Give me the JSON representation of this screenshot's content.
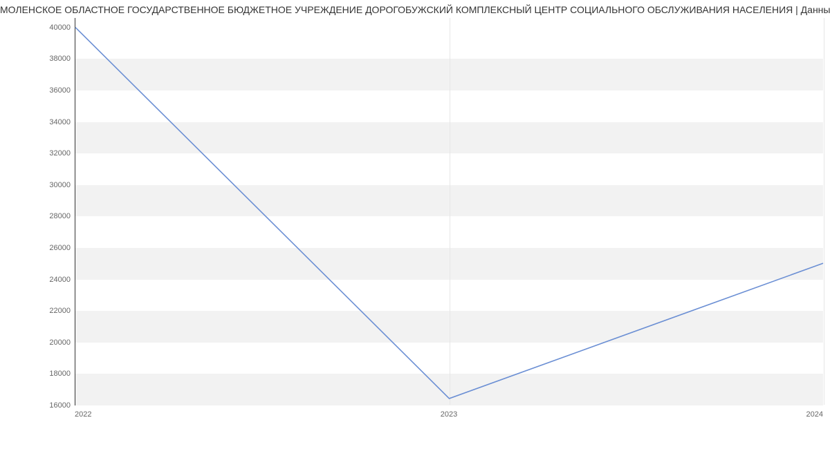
{
  "chart_data": {
    "type": "line",
    "title": "МОЛЕНСКОЕ ОБЛАСТНОЕ ГОСУДАРСТВЕННОЕ БЮДЖЕТНОЕ УЧРЕЖДЕНИЕ ДОРОГОБУЖСКИЙ КОМПЛЕКСНЫЙ ЦЕНТР СОЦИАЛЬНОГО ОБСЛУЖИВАНИЯ НАСЕЛЕНИЯ | Данны",
    "x": [
      2022,
      2023,
      2024
    ],
    "values": [
      40000,
      16400,
      25000
    ],
    "x_ticks": [
      2022,
      2023,
      2024
    ],
    "y_ticks": [
      16000,
      18000,
      20000,
      22000,
      24000,
      26000,
      28000,
      30000,
      32000,
      34000,
      36000,
      38000,
      40000
    ],
    "xlim": [
      2022,
      2024
    ],
    "ylim": [
      16000,
      40600
    ],
    "xlabel": "",
    "ylabel": "",
    "line_color": "#6b8fd4"
  }
}
